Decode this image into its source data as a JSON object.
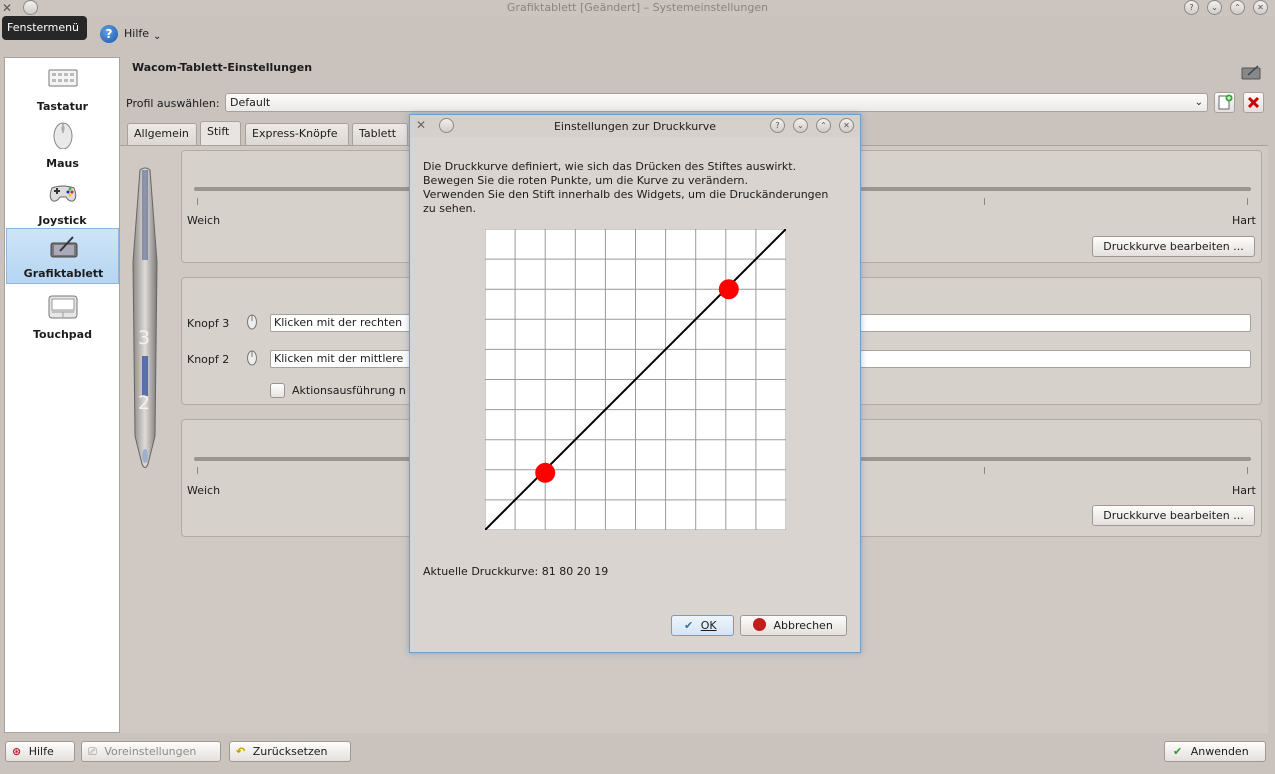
{
  "window": {
    "title": "Grafiktablett [Geändert] – Systemeinstellungen",
    "tooltip": "Fenstermenü",
    "help_menu": "Hilfe"
  },
  "sidebar": {
    "items": [
      {
        "label": "Tastatur",
        "icon": "keyboard-icon"
      },
      {
        "label": "Maus",
        "icon": "mouse-icon"
      },
      {
        "label": "Joystick",
        "icon": "gamepad-icon"
      },
      {
        "label": "Grafiktablett",
        "icon": "tablet-icon",
        "selected": true
      },
      {
        "label": "Touchpad",
        "icon": "touchpad-icon"
      }
    ]
  },
  "page": {
    "title": "Wacom-Tablett-Einstellungen",
    "profile_label": "Profil auswählen:",
    "profile_value": "Default",
    "tabs": [
      "Allgemein",
      "Stift",
      "Express-Knöpfe",
      "Tablett"
    ],
    "active_tab": "Stift",
    "pen": {
      "top_slider": {
        "left": "Weich",
        "right": "Hart",
        "button": "Druckkurve bearbeiten ..."
      },
      "buttons": [
        {
          "label": "Knopf 3",
          "value": "Klicken mit der rechten"
        },
        {
          "label": "Knopf 2",
          "value": "Klicken mit der mittlere"
        }
      ],
      "checkbox_label": "Aktionsausführung n",
      "pen_numbers": [
        "3",
        "2"
      ],
      "bottom_slider": {
        "left": "Weich",
        "right": "Hart",
        "button": "Druckkurve bearbeiten ..."
      }
    }
  },
  "footer": {
    "help": "Hilfe",
    "defaults": "Voreinstellungen",
    "reset": "Zurücksetzen",
    "apply": "Anwenden"
  },
  "dialog": {
    "title": "Einstellungen zur Druckkurve",
    "description": [
      "Die Druckkurve definiert, wie sich das Drücken des Stiftes auswirkt.",
      "Bewegen Sie die roten Punkte, um die Kurve zu verändern.",
      "Verwenden Sie den Stift innerhalb des Widgets, um die Druckänderungen",
      "zu sehen."
    ],
    "current_curve_label": "Aktuelle Druckkurve: 81 80 20 19",
    "ok": "OK",
    "cancel": "Abbrechen",
    "curve": {
      "control_points": [
        {
          "x": 0.2,
          "y": 0.19
        },
        {
          "x": 0.81,
          "y": 0.8
        }
      ],
      "point_color": "#ff0000",
      "grid_divisions": 10
    }
  }
}
